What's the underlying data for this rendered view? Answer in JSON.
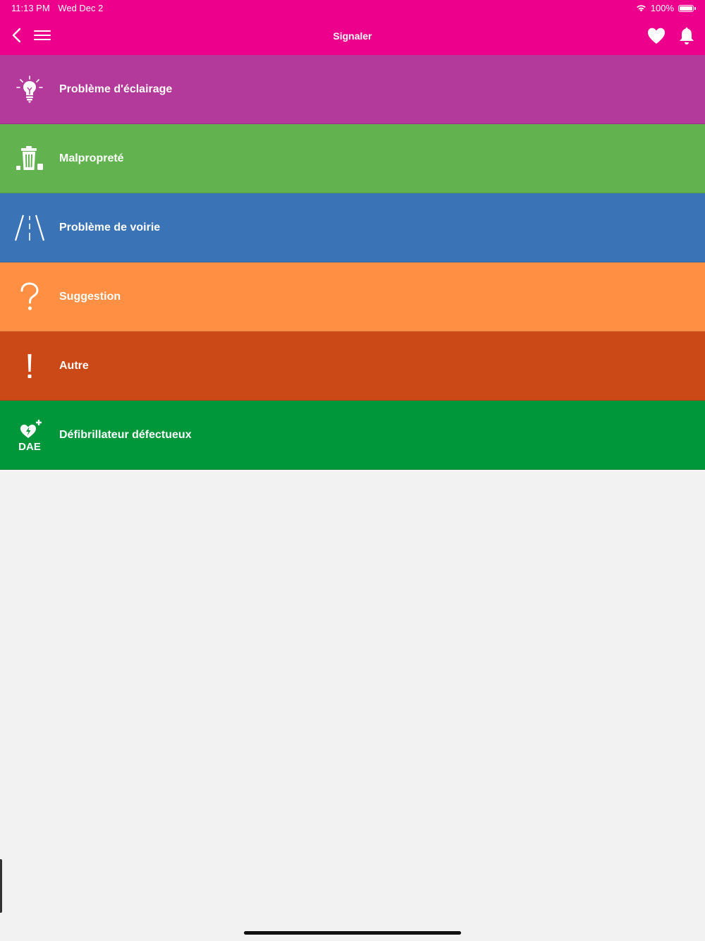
{
  "status_bar": {
    "time": "11:13 PM",
    "date": "Wed Dec 2",
    "battery": "100%"
  },
  "nav": {
    "title": "Signaler",
    "icons": [
      "chevron-left-icon",
      "hamburger-menu-icon",
      "heart-icon",
      "bell-icon"
    ]
  },
  "categories": [
    {
      "label": "Problème d'éclairage",
      "icon": "lightbulb-icon",
      "color": "#b33a9b"
    },
    {
      "label": "Malpropreté",
      "icon": "trash-icon",
      "color": "#62b34f"
    },
    {
      "label": "Problème de voirie",
      "icon": "road-icon",
      "color": "#3b74b6"
    },
    {
      "label": "Suggestion",
      "icon": "question-mark-icon",
      "color": "#ff8f43"
    },
    {
      "label": "Autre",
      "icon": "exclamation-icon",
      "color": "#cb4817"
    },
    {
      "label": "Défibrillateur défectueux",
      "icon": "defibrillator-icon",
      "color": "#00973a",
      "icon_text": "DAE"
    }
  ],
  "theme": {
    "accent": "#ec008c",
    "background": "#f2f2f2"
  }
}
